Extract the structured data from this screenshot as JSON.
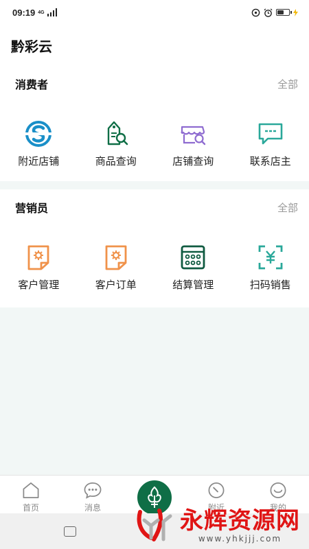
{
  "status_bar": {
    "time": "09:19",
    "network": "4G"
  },
  "app": {
    "title": "黔彩云"
  },
  "consumer": {
    "title": "消费者",
    "all_label": "全部",
    "items": [
      {
        "label": "附近店铺",
        "icon": "nearby-store-icon"
      },
      {
        "label": "商品查询",
        "icon": "product-search-icon"
      },
      {
        "label": "店铺查询",
        "icon": "store-search-icon"
      },
      {
        "label": "联系店主",
        "icon": "contact-owner-icon"
      }
    ]
  },
  "sales": {
    "title": "营销员",
    "all_label": "全部",
    "items": [
      {
        "label": "客户管理",
        "icon": "customer-manage-icon"
      },
      {
        "label": "客户订单",
        "icon": "customer-order-icon"
      },
      {
        "label": "结算管理",
        "icon": "settlement-icon"
      },
      {
        "label": "扫码销售",
        "icon": "scan-sale-icon"
      }
    ]
  },
  "tabs": [
    {
      "label": "首页",
      "icon": "home-icon"
    },
    {
      "label": "消息",
      "icon": "message-icon"
    },
    {
      "label": "",
      "icon": "center-logo-icon"
    },
    {
      "label": "附近",
      "icon": "compass-icon"
    },
    {
      "label": "我的",
      "icon": "smile-icon"
    }
  ],
  "watermark": {
    "text": "永辉资源网",
    "url": "www.yhkjjj.com"
  },
  "colors": {
    "primary": "#0f6e46",
    "blue": "#1a8fc8",
    "purple": "#8e6bd0",
    "teal": "#2aa89a",
    "orange": "#f0924a",
    "watermark_red": "#e01515"
  }
}
